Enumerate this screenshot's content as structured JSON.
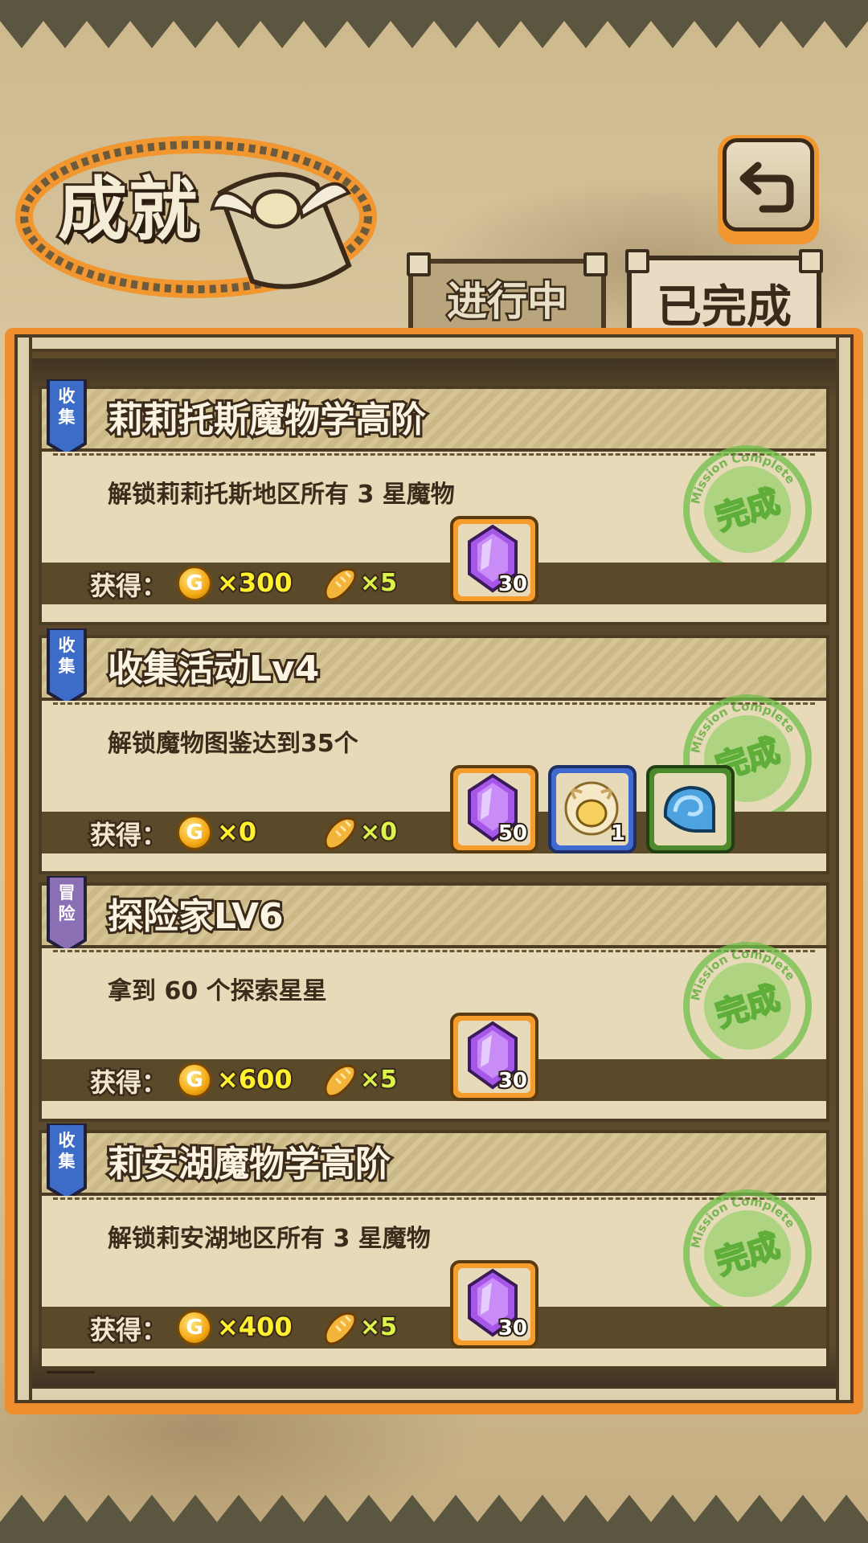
{
  "header": {
    "title": "成就",
    "back_icon": "back-arrow-icon"
  },
  "tabs": [
    {
      "label": "进行中",
      "active": false
    },
    {
      "label": "已完成",
      "active": true
    }
  ],
  "reward_prefix": "获得：",
  "stamp_text": "完成",
  "stamp_ring_text": "Mission Complete",
  "achievements": [
    {
      "tag": "收\n集",
      "tag_color": "#3c6cc8",
      "title": "莉莉托斯魔物学高阶",
      "description": "解锁莉莉托斯地区所有 3 星魔物",
      "coins": "×300",
      "bread": "×5",
      "items": [
        {
          "type": "crystal-icon",
          "qty": "30",
          "frame": "orange"
        }
      ]
    },
    {
      "tag": "收\n集",
      "tag_color": "#3c6cc8",
      "title": "收集活动Lv4",
      "description": "解锁魔物图鉴达到35个",
      "coins": "×0",
      "bread": "×0",
      "items": [
        {
          "type": "crystal-icon",
          "qty": "50",
          "frame": "orange"
        },
        {
          "type": "egg-creature-icon",
          "qty": "1",
          "frame": "blue"
        },
        {
          "type": "blue-horn-icon",
          "qty": "",
          "frame": "green"
        }
      ]
    },
    {
      "tag": "冒\n险",
      "tag_color": "#8a6fb4",
      "title": "探险家LV6",
      "description": "拿到 60 个探索星星",
      "coins": "×600",
      "bread": "×5",
      "items": [
        {
          "type": "crystal-icon",
          "qty": "30",
          "frame": "orange"
        }
      ]
    },
    {
      "tag": "收\n集",
      "tag_color": "#3c6cc8",
      "title": "莉安湖魔物学高阶",
      "description": "解锁莉安湖地区所有 3 星魔物",
      "coins": "×400",
      "bread": "×5",
      "items": [
        {
          "type": "crystal-icon",
          "qty": "30",
          "frame": "orange"
        }
      ]
    }
  ]
}
